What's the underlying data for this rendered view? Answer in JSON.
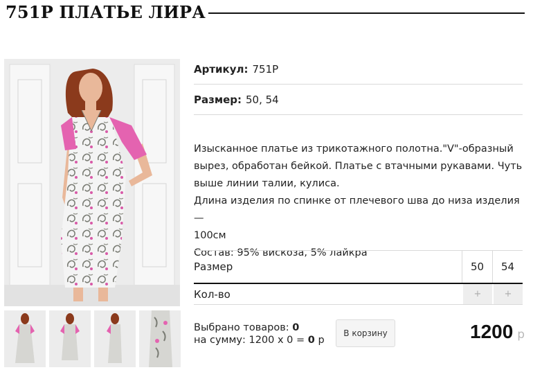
{
  "header": {
    "title": "751P ПЛАТЬЕ ЛИРА"
  },
  "details": {
    "article_label": "Артикул:",
    "article_value": "751P",
    "size_label": "Размер:",
    "size_value": "50, 54"
  },
  "description": {
    "line1": "Изысканное платье из трикотажного полотна.\"V\"-образный",
    "line2": "вырез, обработан бейкой. Платье с втачными рукавами. Чуть",
    "line3": "выше линии талии, кулиса.",
    "line4": "Длина изделия по спинке от плечевого шва до низа изделия —",
    "line5": "100см",
    "line6": "Состав: 95% вискоза, 5% лайкра"
  },
  "options": {
    "size_label": "Размер",
    "sizes": [
      "50",
      "54"
    ],
    "qty_label": "Кол-во",
    "plus_symbol": "+"
  },
  "summary": {
    "selected_label": "Выбрано товаров:",
    "selected_count": "0",
    "sum_label": "на сумму: 1200 х 0 =",
    "sum_value": "0",
    "sum_currency": "р"
  },
  "cart_button": "В корзину",
  "price": {
    "value": "1200",
    "currency": "р"
  },
  "colors": {
    "pink_sleeve": "#e463b0",
    "dress_base": "#f5f5f5",
    "paisley": "#7a7c74",
    "hair": "#8b3a1c",
    "skin": "#e9b89a",
    "background": "#ececec"
  }
}
